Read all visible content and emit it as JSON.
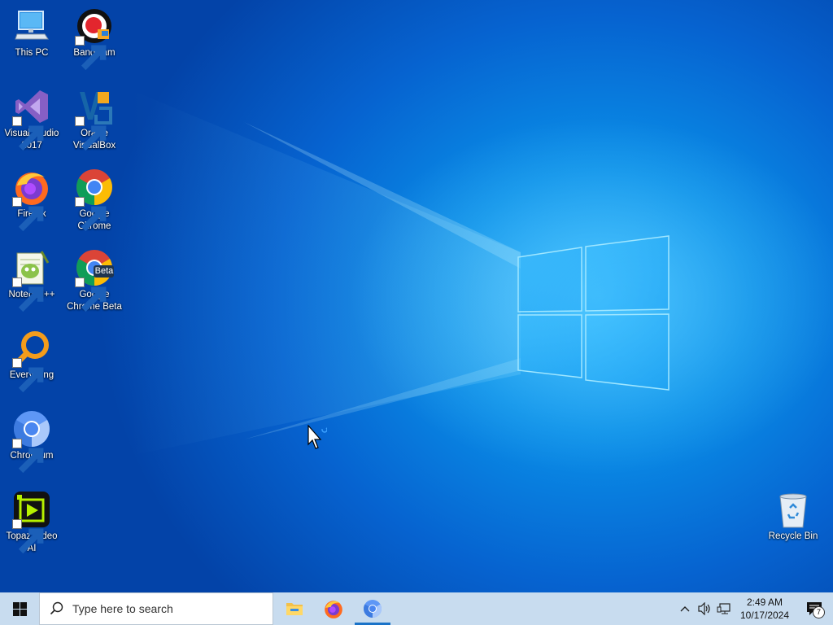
{
  "desktop": {
    "icons": [
      {
        "label": "This PC",
        "icon": "computer-icon"
      },
      {
        "label": "Bandicam",
        "icon": "bandicam-icon"
      },
      {
        "label": "Visual Studio 2017",
        "icon": "visual-studio-icon"
      },
      {
        "label": "Oracle VirtualBox",
        "icon": "virtualbox-icon"
      },
      {
        "label": "Firefox",
        "icon": "firefox-icon"
      },
      {
        "label": "Google Chrome",
        "icon": "chrome-icon"
      },
      {
        "label": "Notepad++",
        "icon": "notepadpp-icon"
      },
      {
        "label": "Google Chrome Beta",
        "icon": "chrome-beta-icon",
        "badge": "Beta"
      },
      {
        "label": "Everything",
        "icon": "everything-search-icon"
      },
      {
        "label": "Chromium",
        "icon": "chromium-icon"
      },
      {
        "label": "Topaz Video AI",
        "icon": "topaz-video-icon"
      },
      {
        "label": "Recycle Bin",
        "icon": "recycle-bin-icon"
      }
    ]
  },
  "taskbar": {
    "search_placeholder": "Type here to search",
    "pinned": [
      {
        "name": "File Explorer",
        "icon": "folder-icon"
      },
      {
        "name": "Firefox",
        "icon": "firefox-icon"
      },
      {
        "name": "Chromium",
        "icon": "chromium-icon",
        "active": true
      }
    ],
    "clock": {
      "time": "2:49 AM",
      "date": "10/17/2024"
    },
    "notification_count": "7"
  },
  "colors": {
    "wallpaper_accent": "#0a8fe8",
    "taskbar_bg": "#c8dcef",
    "active_indicator": "#1a73c8"
  }
}
